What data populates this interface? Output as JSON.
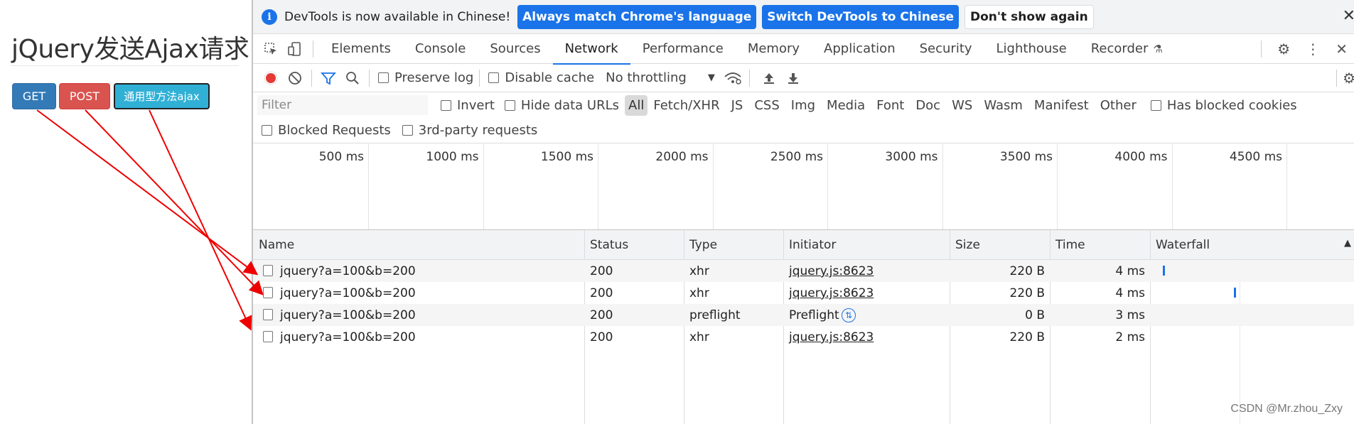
{
  "page": {
    "heading": "jQuery发送Ajax请求",
    "buttons": {
      "get": "GET",
      "post": "POST",
      "ajax": "通用型方法ajax"
    }
  },
  "infobar": {
    "message": "DevTools is now available in Chinese!",
    "match_btn": "Always match Chrome's language",
    "switch_btn": "Switch DevTools to Chinese",
    "dismiss_btn": "Don't show again",
    "close": "✕"
  },
  "tabs": {
    "items": [
      "Elements",
      "Console",
      "Sources",
      "Network",
      "Performance",
      "Memory",
      "Application",
      "Security",
      "Lighthouse",
      "Recorder"
    ],
    "active": "Network"
  },
  "toolbar": {
    "preserve_log": "Preserve log",
    "disable_cache": "Disable cache",
    "throttling": "No throttling"
  },
  "filter": {
    "placeholder": "Filter",
    "invert": "Invert",
    "hide_data_urls": "Hide data URLs",
    "types": [
      "All",
      "Fetch/XHR",
      "JS",
      "CSS",
      "Img",
      "Media",
      "Font",
      "Doc",
      "WS",
      "Wasm",
      "Manifest",
      "Other"
    ],
    "has_blocked_cookies": "Has blocked cookies",
    "blocked_requests": "Blocked Requests",
    "third_party": "3rd-party requests"
  },
  "overview": {
    "ticks": [
      "500 ms",
      "1000 ms",
      "1500 ms",
      "2000 ms",
      "2500 ms",
      "3000 ms",
      "3500 ms",
      "4000 ms",
      "4500 ms"
    ]
  },
  "table": {
    "headers": {
      "name": "Name",
      "status": "Status",
      "type": "Type",
      "initiator": "Initiator",
      "size": "Size",
      "time": "Time",
      "waterfall": "Waterfall"
    },
    "rows": [
      {
        "name": "jquery?a=100&b=200",
        "status": "200",
        "type": "xhr",
        "initiator": "jquery.js:8623",
        "size": "220 B",
        "time": "4 ms"
      },
      {
        "name": "jquery?a=100&b=200",
        "status": "200",
        "type": "xhr",
        "initiator": "jquery.js:8623",
        "size": "220 B",
        "time": "4 ms"
      },
      {
        "name": "jquery?a=100&b=200",
        "status": "200",
        "type": "preflight",
        "initiator": "Preflight",
        "size": "0 B",
        "time": "3 ms"
      },
      {
        "name": "jquery?a=100&b=200",
        "status": "200",
        "type": "xhr",
        "initiator": "jquery.js:8623",
        "size": "220 B",
        "time": "2 ms"
      }
    ]
  },
  "watermark": "CSDN @Mr.zhou_Zxy",
  "colors": {
    "accent": "#1a73e8",
    "get": "#337ab7",
    "post": "#d9534f",
    "ajax": "#31b0d5",
    "arrow": "#ee0000"
  }
}
